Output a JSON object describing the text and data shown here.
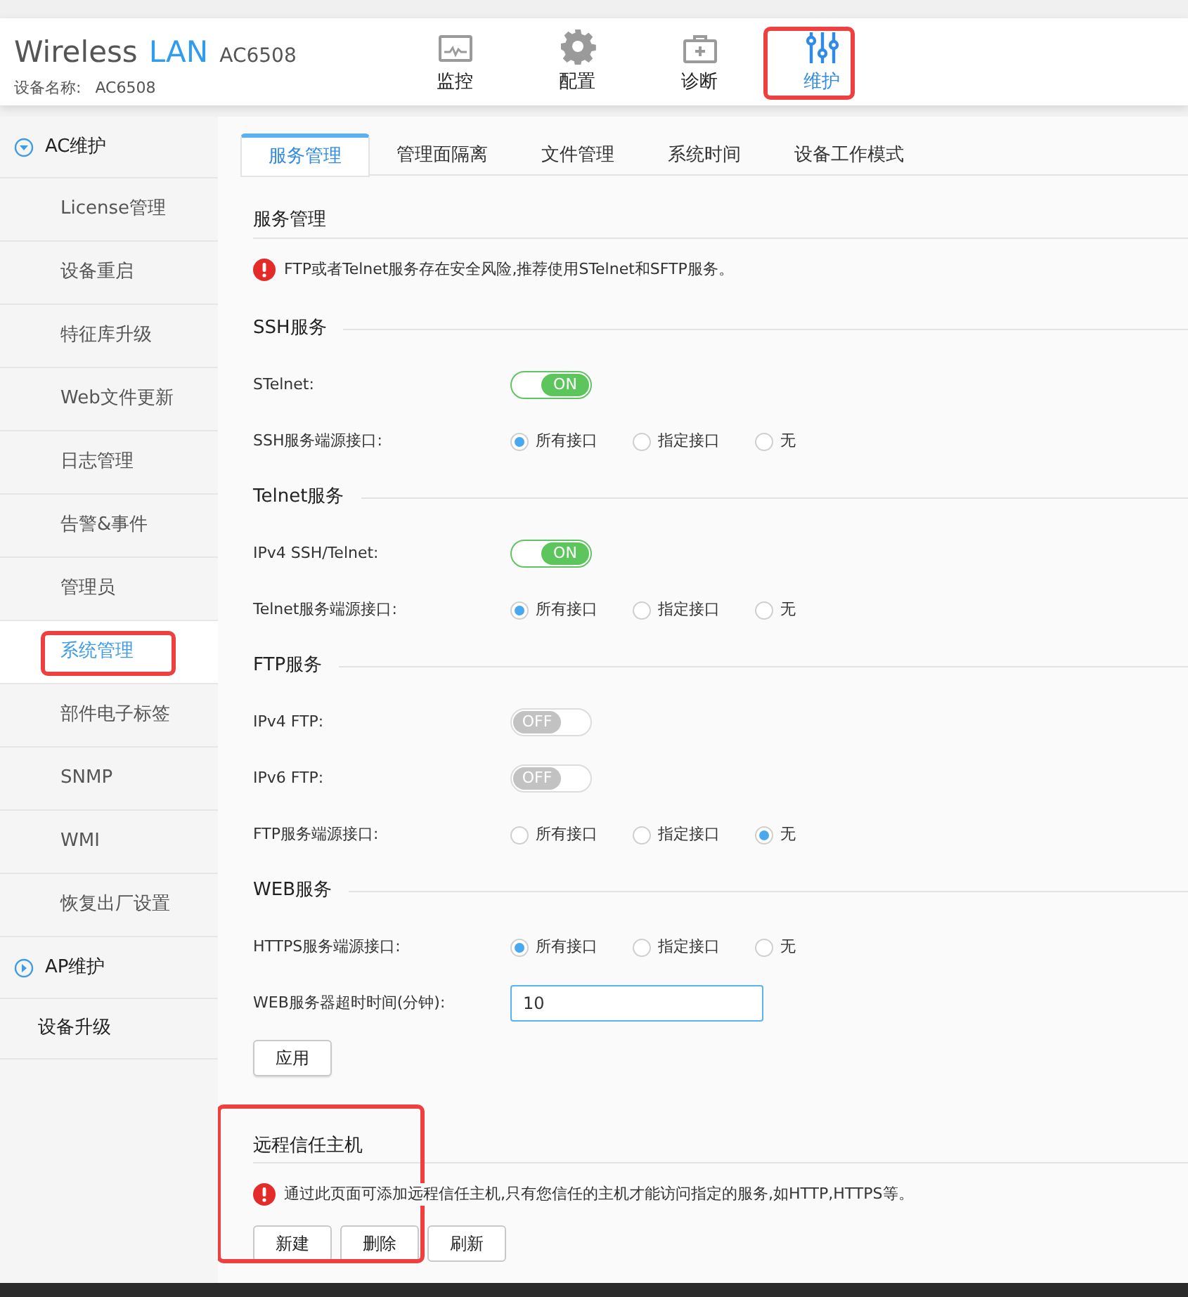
{
  "header": {
    "brand": "Wireless",
    "brand_accent": "LAN",
    "model": "AC6508",
    "device_label": "设备名称:",
    "device_name": "AC6508"
  },
  "nav": [
    {
      "label": "监控",
      "selected": false,
      "annotated": false
    },
    {
      "label": "配置",
      "selected": false,
      "annotated": false
    },
    {
      "label": "诊断",
      "selected": false,
      "annotated": false
    },
    {
      "label": "维护",
      "selected": true,
      "annotated": true
    }
  ],
  "sidebar": [
    {
      "kind": "group",
      "label": "AC维护",
      "expanded": true,
      "children": [
        {
          "label": "License管理",
          "selected": false,
          "annotated": false
        },
        {
          "label": "设备重启",
          "selected": false,
          "annotated": false
        },
        {
          "label": "特征库升级",
          "selected": false,
          "annotated": false
        },
        {
          "label": "Web文件更新",
          "selected": false,
          "annotated": false
        },
        {
          "label": "日志管理",
          "selected": false,
          "annotated": false
        },
        {
          "label": "告警&事件",
          "selected": false,
          "annotated": false
        },
        {
          "label": "管理员",
          "selected": false,
          "annotated": false
        },
        {
          "label": "系统管理",
          "selected": true,
          "annotated": true
        },
        {
          "label": "部件电子标签",
          "selected": false,
          "annotated": false
        },
        {
          "label": "SNMP",
          "selected": false,
          "annotated": false
        },
        {
          "label": "WMI",
          "selected": false,
          "annotated": false
        },
        {
          "label": "恢复出厂设置",
          "selected": false,
          "annotated": false
        }
      ]
    },
    {
      "kind": "group",
      "label": "AP维护",
      "expanded": false
    },
    {
      "kind": "link",
      "label": "设备升级"
    }
  ],
  "tabs": [
    {
      "label": "服务管理",
      "selected": true
    },
    {
      "label": "管理面隔离",
      "selected": false
    },
    {
      "label": "文件管理",
      "selected": false
    },
    {
      "label": "系统时间",
      "selected": false
    },
    {
      "label": "设备工作模式",
      "selected": false
    }
  ],
  "service_panel": {
    "title": "服务管理",
    "notice": "FTP或者Telnet服务存在安全风险,推荐使用STelnet和SFTP服务。",
    "groups": [
      {
        "title": "SSH服务",
        "rows": [
          {
            "kind": "toggle",
            "label": "STelnet:",
            "on": true,
            "state_text": "ON"
          },
          {
            "kind": "radio",
            "label": "SSH服务端源接口:",
            "options": [
              {
                "label": "所有接口",
                "selected": true
              },
              {
                "label": "指定接口",
                "selected": false
              },
              {
                "label": "无",
                "selected": false
              }
            ]
          }
        ]
      },
      {
        "title": "Telnet服务",
        "rows": [
          {
            "kind": "toggle",
            "label": "IPv4 SSH/Telnet:",
            "on": true,
            "state_text": "ON"
          },
          {
            "kind": "radio",
            "label": "Telnet服务端源接口:",
            "options": [
              {
                "label": "所有接口",
                "selected": true
              },
              {
                "label": "指定接口",
                "selected": false
              },
              {
                "label": "无",
                "selected": false
              }
            ]
          }
        ]
      },
      {
        "title": "FTP服务",
        "rows": [
          {
            "kind": "toggle",
            "label": "IPv4 FTP:",
            "on": false,
            "state_text": "OFF"
          },
          {
            "kind": "toggle",
            "label": "IPv6 FTP:",
            "on": false,
            "state_text": "OFF"
          },
          {
            "kind": "radio",
            "label": "FTP服务端源接口:",
            "options": [
              {
                "label": "所有接口",
                "selected": false
              },
              {
                "label": "指定接口",
                "selected": false
              },
              {
                "label": "无",
                "selected": true
              }
            ]
          }
        ]
      },
      {
        "title": "WEB服务",
        "rows": [
          {
            "kind": "radio",
            "label": "HTTPS服务端源接口:",
            "options": [
              {
                "label": "所有接口",
                "selected": true
              },
              {
                "label": "指定接口",
                "selected": false
              },
              {
                "label": "无",
                "selected": false
              }
            ]
          },
          {
            "kind": "input",
            "label": "WEB服务器超时时间(分钟):",
            "value": "10"
          }
        ]
      }
    ],
    "apply_button": "应用"
  },
  "trust_panel": {
    "title": "远程信任主机",
    "annotated": true,
    "notice": "通过此页面可添加远程信任主机,只有您信任的主机才能访问指定的服务,如HTTP,HTTPS等。",
    "buttons": [
      "新建",
      "删除",
      "刷新"
    ]
  }
}
